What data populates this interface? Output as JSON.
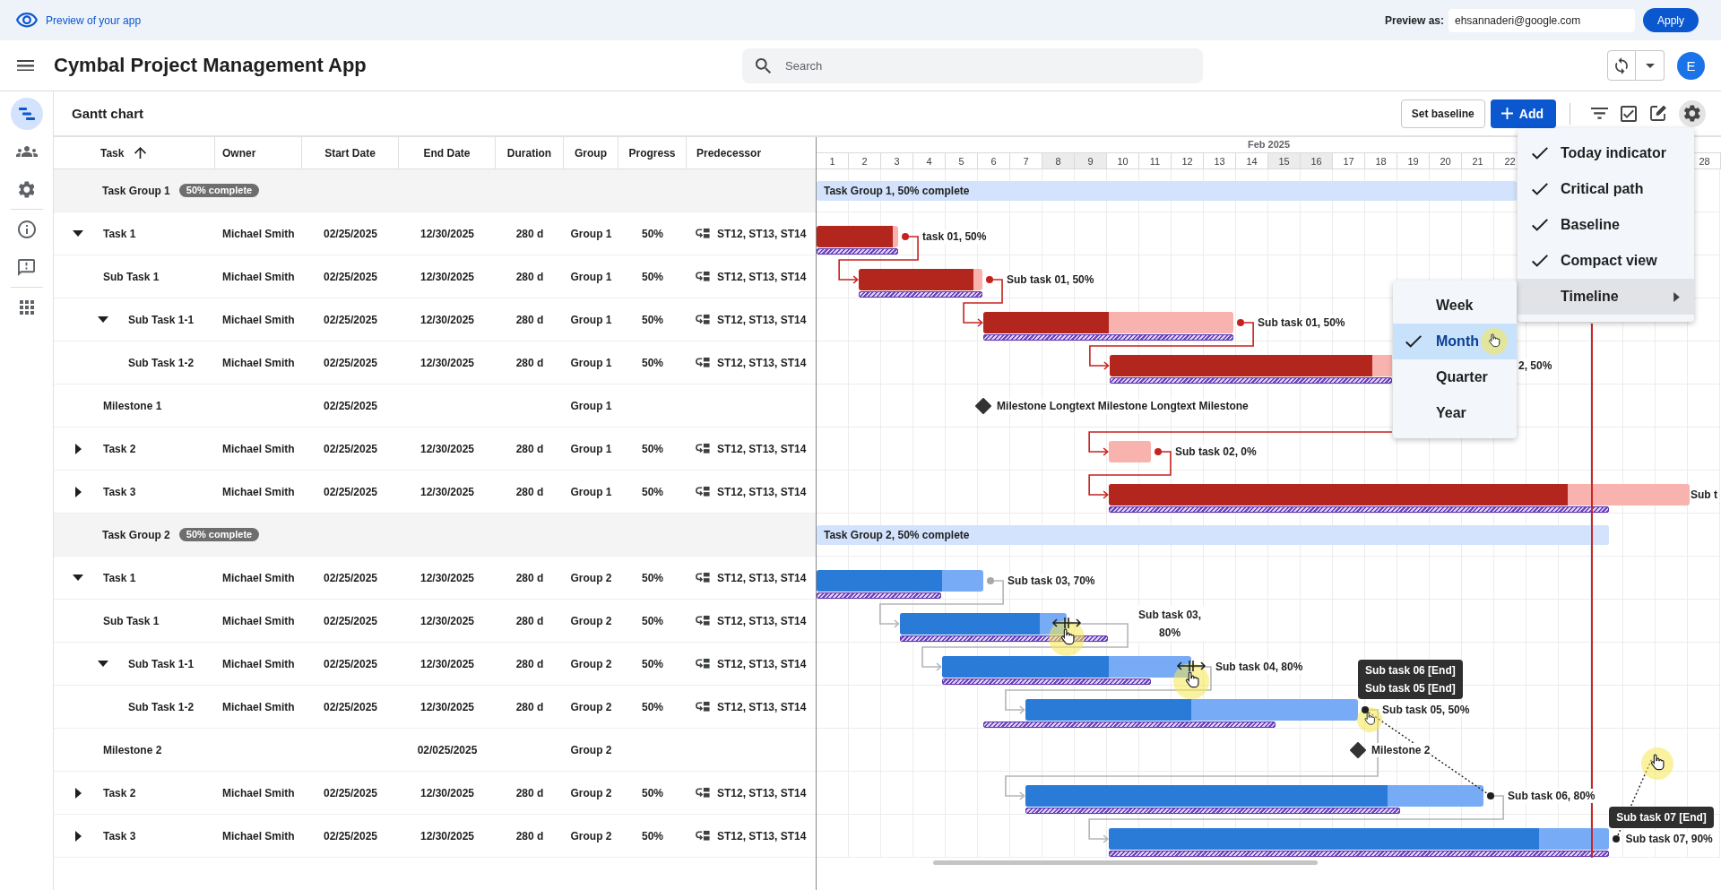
{
  "preview_bar": {
    "label": "Preview of your app",
    "preview_as_label": "Preview as:",
    "preview_as_value": "ehsannaderi@google.com",
    "apply_button": "Apply"
  },
  "app_bar": {
    "title": "Cymbal Project Management App",
    "search": {
      "placeholder": "Search"
    },
    "avatar": "E"
  },
  "rail": {
    "sections": [
      {
        "items": [
          {
            "kind": "gantt",
            "selected": true
          },
          {
            "kind": "people",
            "selected": false
          },
          {
            "kind": "settings",
            "selected": false
          }
        ]
      },
      {
        "items": [
          {
            "kind": "info",
            "selected": false
          },
          {
            "kind": "feedback",
            "selected": false
          }
        ]
      },
      {
        "items": [
          {
            "kind": "apps",
            "selected": false
          }
        ]
      }
    ]
  },
  "toolbar": {
    "title": "Gantt chart",
    "set_baseline_button": "Set baseline",
    "add_button": "Add",
    "icons": [
      {
        "kind": "filter"
      },
      {
        "kind": "checklist"
      },
      {
        "kind": "edit"
      }
    ],
    "settings_button": {
      "active": true
    }
  },
  "table": {
    "columns": [
      {
        "label": "Task",
        "sorted": true
      },
      {
        "label": "Owner",
        "sorted": false
      },
      {
        "label": "Start Date",
        "sorted": false
      },
      {
        "label": "End Date",
        "sorted": false
      },
      {
        "label": "Duration",
        "sorted": false
      },
      {
        "label": "Group",
        "sorted": false
      },
      {
        "label": "Progress",
        "sorted": false
      },
      {
        "label": "Predecessor",
        "sorted": false
      }
    ],
    "groups": [
      {
        "title": "Task Group 1",
        "badge": "50% complete",
        "critical": true,
        "summary": {
          "label": "Task Group 1, 50% complete"
        },
        "rows": [
          {
            "task": "Task 1",
            "owner": "Michael Smith",
            "start_date": "02/25/2025",
            "end_date": "12/30/2025",
            "duration": "280 d",
            "group": "Group 1",
            "progress": "50%",
            "predecessor": "ST12, ST13, ST14",
            "expanded": true,
            "bar": {
              "kind": "task",
              "level": 0.93,
              "baseline": true,
              "handle": true,
              "handle_active": false,
              "label": "task 01, 50%"
            },
            "children": [
              {
                "task": "Sub Task 1",
                "owner": "Michael Smith",
                "start_date": "02/25/2025",
                "end_date": "12/30/2025",
                "duration": "280 d",
                "group": "Group 1",
                "progress": "50%",
                "predecessor": "ST12, ST13, ST14",
                "bar": {
                  "kind": "task",
                  "level": 0.93,
                  "baseline": true,
                  "handle": true,
                  "handle_active": false,
                  "label": "Sub task 01, 50%",
                  "linked": true
                }
              },
              {
                "task": "Sub Task 1-1",
                "owner": "Michael Smith",
                "start_date": "02/25/2025",
                "end_date": "12/30/2025",
                "duration": "280 d",
                "group": "Group 1",
                "progress": "50%",
                "predecessor": "ST12, ST13, ST14",
                "expanded": true,
                "bar": {
                  "kind": "task",
                  "level": 0.5,
                  "baseline": true,
                  "handle": true,
                  "handle_active": false,
                  "label": "Sub task 01, 50%",
                  "linked": true
                },
                "children": [
                  {
                    "task": "Sub Task 1-2",
                    "owner": "Michael Smith",
                    "start_date": "02/25/2025",
                    "end_date": "12/30/2025",
                    "duration": "280 d",
                    "group": "Group 1",
                    "progress": "50%",
                    "predecessor": "ST12, ST13, ST14",
                    "bar": {
                      "kind": "task",
                      "level": 0.93,
                      "baseline": true,
                      "label": "2, 50%",
                      "linked": true
                    }
                  }
                ]
              },
              {
                "task": "Milestone 1",
                "start_date": "02/25/2025",
                "group": "Group 1",
                "bar": {
                  "kind": "milestone",
                  "label": "Milestone Longtext Milestone Longtext Milestone"
                }
              }
            ]
          },
          {
            "task": "Task 2",
            "owner": "Michael Smith",
            "start_date": "02/25/2025",
            "end_date": "12/30/2025",
            "duration": "280 d",
            "group": "Group 1",
            "progress": "50%",
            "predecessor": "ST12, ST13, ST14",
            "expanded": false,
            "bar": {
              "kind": "task",
              "baseline": false,
              "handle": true,
              "handle_active": false,
              "label": "Sub task 02, 0%",
              "linked": true
            }
          },
          {
            "task": "Task 3",
            "owner": "Michael Smith",
            "start_date": "02/25/2025",
            "end_date": "12/30/2025",
            "duration": "280 d",
            "group": "Group 1",
            "progress": "50%",
            "predecessor": "ST12, ST13, ST14",
            "expanded": false,
            "bar": {
              "kind": "task",
              "level": 0.79,
              "baseline": true,
              "handle": false,
              "label": "Sub t",
              "linked": true
            }
          }
        ]
      },
      {
        "title": "Task Group 2",
        "badge": "50% complete",
        "critical": false,
        "summary": {
          "label": "Task Group 2, 50% complete"
        },
        "rows": [
          {
            "task": "Task 1",
            "owner": "Michael Smith",
            "start_date": "02/25/2025",
            "end_date": "12/30/2025",
            "duration": "280 d",
            "group": "Group 2",
            "progress": "50%",
            "predecessor": "ST12, ST13, ST14",
            "expanded": true,
            "bar": {
              "kind": "task",
              "level": 0.75,
              "baseline": true,
              "handle": true,
              "handle_active": false,
              "label": "Sub task 03, 70%"
            },
            "children": [
              {
                "task": "Sub Task 1",
                "owner": "Michael Smith",
                "start_date": "02/25/2025",
                "end_date": "12/30/2025",
                "duration": "280 d",
                "group": "Group 2",
                "progress": "50%",
                "predecessor": "ST12, ST13, ST14",
                "bar": {
                  "kind": "task",
                  "level": 0.84,
                  "baseline": true,
                  "handle": false,
                  "cursor": {
                    "kind": "resize"
                  },
                  "label": "Sub task 03, 80%",
                  "wrapped": true,
                  "linked": true
                }
              },
              {
                "task": "Sub Task 1-1",
                "owner": "Michael Smith",
                "start_date": "02/25/2025",
                "end_date": "12/30/2025",
                "duration": "280 d",
                "group": "Group 2",
                "progress": "50%",
                "predecessor": "ST12, ST13, ST14",
                "expanded": true,
                "bar": {
                  "kind": "task",
                  "level": 0.67,
                  "baseline": true,
                  "handle": false,
                  "cursor": {
                    "kind": "resize"
                  },
                  "label": "Sub task 04, 80%",
                  "linked": true
                },
                "children": [
                  {
                    "task": "Sub Task 1-2",
                    "owner": "Michael Smith",
                    "start_date": "02/25/2025",
                    "end_date": "12/30/2025",
                    "duration": "280 d",
                    "group": "Group 2",
                    "progress": "50%",
                    "predecessor": "ST12, ST13, ST14",
                    "bar": {
                      "kind": "task",
                      "level": 0.5,
                      "baseline": true,
                      "handle": true,
                      "handle_active": true,
                      "cursor": {
                        "kind": "pointer"
                      },
                      "link_preview": true,
                      "tooltip": [
                        "Sub task 06 [End]",
                        "Sub task 05 [End]"
                      ],
                      "label": "Sub task 05, 50%",
                      "linked": true
                    }
                  }
                ]
              },
              {
                "task": "Milestone 2",
                "end_date": "02/025/2025",
                "group": "Group 2",
                "bar": {
                  "kind": "milestone",
                  "label": "Milestone 2"
                }
              }
            ]
          },
          {
            "task": "Task 2",
            "owner": "Michael Smith",
            "start_date": "02/25/2025",
            "end_date": "12/30/2025",
            "duration": "280 d",
            "group": "Group 2",
            "progress": "50%",
            "predecessor": "ST12, ST13, ST14",
            "expanded": false,
            "bar": {
              "kind": "task",
              "level": 0.79,
              "baseline": true,
              "handle": true,
              "handle_active": true,
              "label": "Sub task 06, 80%",
              "linked": true
            }
          },
          {
            "task": "Task 3",
            "owner": "Michael Smith",
            "start_date": "02/25/2025",
            "end_date": "12/30/2025",
            "duration": "280 d",
            "group": "Group 2",
            "progress": "50%",
            "predecessor": "ST12, ST13, ST14",
            "expanded": false,
            "bar": {
              "kind": "task",
              "level": 0.86,
              "baseline": true,
              "handle": true,
              "handle_active": true,
              "cursor": {
                "kind": "drag"
              },
              "tooltip": [
                "Sub task 07 [End]"
              ],
              "label": "Sub task 07, 90%",
              "linked": true
            }
          }
        ]
      }
    ]
  },
  "timeline": {
    "month": "Feb 2025",
    "days": [
      {
        "label": "1",
        "shaded": false
      },
      {
        "label": "2",
        "shaded": false
      },
      {
        "label": "3",
        "shaded": false
      },
      {
        "label": "4",
        "shaded": false
      },
      {
        "label": "5",
        "shaded": false
      },
      {
        "label": "6",
        "shaded": false
      },
      {
        "label": "7",
        "shaded": false
      },
      {
        "label": "8",
        "shaded": true
      },
      {
        "label": "9",
        "shaded": true
      },
      {
        "label": "10",
        "shaded": false
      },
      {
        "label": "11",
        "shaded": false
      },
      {
        "label": "12",
        "shaded": false
      },
      {
        "label": "13",
        "shaded": false
      },
      {
        "label": "14",
        "shaded": false
      },
      {
        "label": "15",
        "shaded": true
      },
      {
        "label": "16",
        "shaded": true
      },
      {
        "label": "17",
        "shaded": false
      },
      {
        "label": "18",
        "shaded": false
      },
      {
        "label": "19",
        "shaded": false
      },
      {
        "label": "20",
        "shaded": false
      },
      {
        "label": "21",
        "shaded": false
      },
      {
        "label": "22",
        "shaded": false
      }
    ],
    "days_end": [
      {
        "label": "28",
        "shaded": false
      }
    ],
    "today_indicator": true
  },
  "settings_menu": {
    "items": [
      {
        "kind": "toggle",
        "label": "Today indicator",
        "checked": true
      },
      {
        "kind": "toggle",
        "label": "Critical path",
        "checked": true
      },
      {
        "kind": "toggle",
        "label": "Baseline",
        "checked": true
      },
      {
        "kind": "toggle",
        "label": "Compact view",
        "checked": true
      },
      {
        "kind": "submenu",
        "label": "Timeline",
        "expanded": true,
        "items": [
          {
            "label": "Week",
            "selected": false,
            "hovered": false
          },
          {
            "label": "Month",
            "selected": true,
            "hovered": true
          },
          {
            "label": "Quarter",
            "selected": false,
            "hovered": false
          },
          {
            "label": "Year",
            "selected": false,
            "hovered": false
          }
        ]
      }
    ]
  }
}
